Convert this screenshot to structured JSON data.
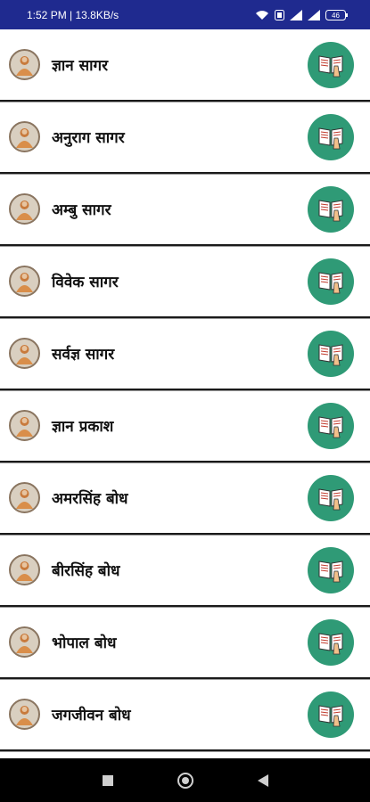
{
  "status_bar": {
    "time_speed": "1:52 PM | 13.8KB/s",
    "battery": "46",
    "background_color": "#1f2a8f"
  },
  "books": [
    {
      "label": "ज्ञान सागर"
    },
    {
      "label": "अनुराग सागर"
    },
    {
      "label": "अम्बु सागर"
    },
    {
      "label": "विवेक सागर"
    },
    {
      "label": "सर्वज्ञ सागर"
    },
    {
      "label": "ज्ञान प्रकाश"
    },
    {
      "label": "अमरसिंह बोध"
    },
    {
      "label": "बीरसिंह बोध"
    },
    {
      "label": "भोपाल बोध"
    },
    {
      "label": "जगजीवन बोध"
    }
  ],
  "icons": {
    "avatar": "guru-portrait-icon",
    "read_button": "open-book-icon",
    "nav_recent": "square-recents-icon",
    "nav_home": "circle-home-icon",
    "nav_back": "triangle-back-icon"
  },
  "colors": {
    "read_button": "#2f9a76"
  }
}
